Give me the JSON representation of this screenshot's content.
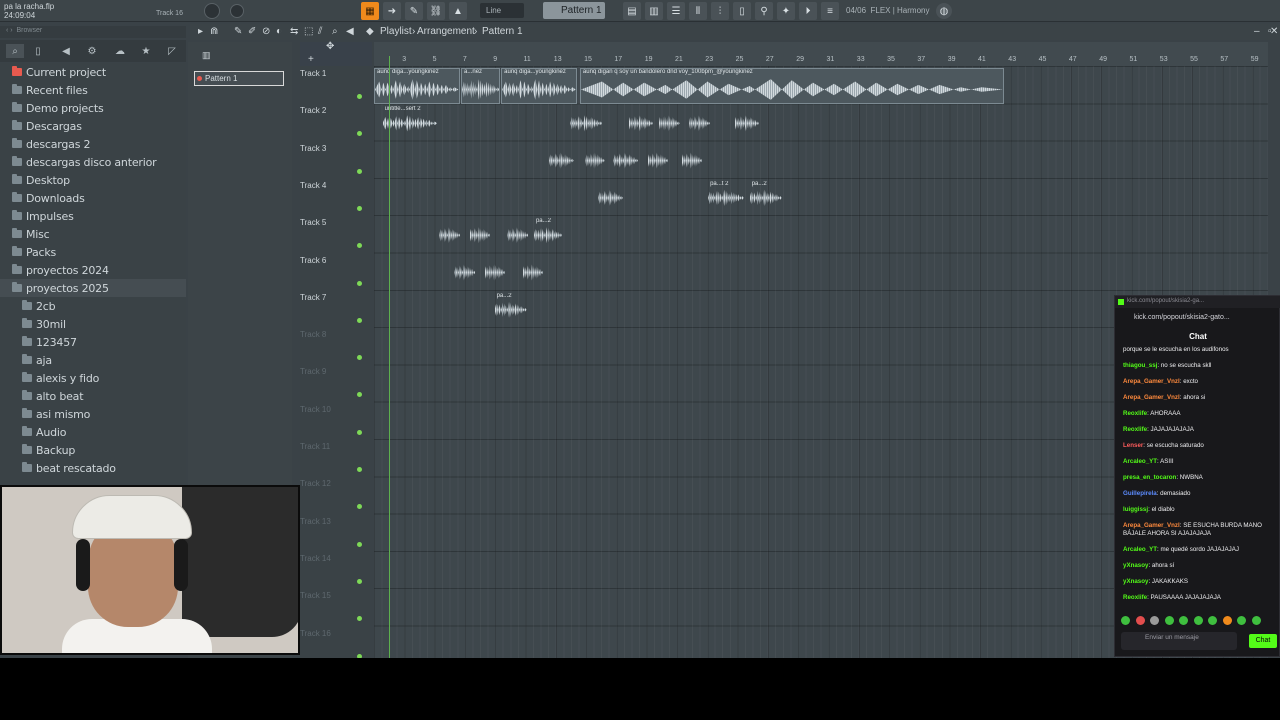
{
  "window": {
    "project_file": "pa la racha.flp",
    "time": "24:09:04",
    "track_hint": "Track 16",
    "snap_mode": "Line",
    "pattern_selector": "Pattern 1",
    "plugin_label": "FLEX | Harmony",
    "cpu_label": "04/06"
  },
  "browser": {
    "header": "Browser",
    "items": [
      {
        "label": "Current project",
        "level": 0,
        "current": true
      },
      {
        "label": "Recent files",
        "level": 0
      },
      {
        "label": "Demo projects",
        "level": 0
      },
      {
        "label": "Descargas",
        "level": 0
      },
      {
        "label": "descargas 2",
        "level": 0
      },
      {
        "label": "descargas disco anterior",
        "level": 0
      },
      {
        "label": "Desktop",
        "level": 0
      },
      {
        "label": "Downloads",
        "level": 0
      },
      {
        "label": "Impulses",
        "level": 0
      },
      {
        "label": "Misc",
        "level": 0
      },
      {
        "label": "Packs",
        "level": 0
      },
      {
        "label": "proyectos 2024",
        "level": 0
      },
      {
        "label": "proyectos 2025",
        "level": 0,
        "selected": true
      },
      {
        "label": "2cb",
        "level": 1
      },
      {
        "label": "30mil",
        "level": 1
      },
      {
        "label": "123457",
        "level": 1
      },
      {
        "label": "aja",
        "level": 1
      },
      {
        "label": "alexis y fido",
        "level": 1
      },
      {
        "label": "alto beat",
        "level": 1
      },
      {
        "label": "asi mismo",
        "level": 1
      },
      {
        "label": "Audio",
        "level": 1
      },
      {
        "label": "Backup",
        "level": 1
      },
      {
        "label": "beat rescatado",
        "level": 1
      }
    ]
  },
  "picker": {
    "pattern_label": "Pattern 1"
  },
  "playlist": {
    "title_parts": [
      "Playlist",
      "Arrangement",
      "Pattern 1"
    ],
    "ruler_numbers": [
      "3",
      "5",
      "7",
      "9",
      "11",
      "13",
      "15",
      "17",
      "19",
      "21",
      "23",
      "25",
      "27",
      "29",
      "31",
      "33",
      "35",
      "37",
      "39",
      "41",
      "43",
      "45",
      "47",
      "49",
      "51",
      "53",
      "55",
      "57",
      "59"
    ],
    "tracks": [
      "Track 1",
      "Track 2",
      "Track 3",
      "Track 4",
      "Track 5",
      "Track 6",
      "Track 7",
      "Track 8",
      "Track 9",
      "Track 10",
      "Track 11",
      "Track 12",
      "Track 13",
      "Track 14",
      "Track 15",
      "Track 16"
    ],
    "clips": [
      {
        "track": 0,
        "start": 0,
        "len": 11.3,
        "label": "aunq diga...youngkinez",
        "style": "full"
      },
      {
        "track": 0,
        "start": 11.5,
        "len": 5.2,
        "label": "a...nez",
        "style": "full"
      },
      {
        "track": 0,
        "start": 16.8,
        "len": 10.0,
        "label": "aunq diga...youngkinez",
        "style": "full"
      },
      {
        "track": 0,
        "start": 27.2,
        "len": 56.0,
        "label": "aunq digan q soy un bandolero dnd voy_100bpm_@youngkinez",
        "style": "full"
      },
      {
        "track": 1,
        "start": 1.0,
        "len": 7.5,
        "label": "untitle...sert 2",
        "style": "small"
      },
      {
        "track": 1,
        "start": 25.8,
        "len": 4.5,
        "label": "",
        "style": "small"
      },
      {
        "track": 1,
        "start": 33.5,
        "len": 3.5,
        "label": "",
        "style": "small"
      },
      {
        "track": 1,
        "start": 37.5,
        "len": 3.0,
        "label": "",
        "style": "small"
      },
      {
        "track": 1,
        "start": 41.5,
        "len": 3.0,
        "label": "",
        "style": "small"
      },
      {
        "track": 1,
        "start": 47.5,
        "len": 3.5,
        "label": "",
        "style": "small"
      },
      {
        "track": 2,
        "start": 23.0,
        "len": 3.5,
        "label": "",
        "style": "small"
      },
      {
        "track": 2,
        "start": 27.8,
        "len": 2.8,
        "label": "",
        "style": "small"
      },
      {
        "track": 2,
        "start": 31.5,
        "len": 3.5,
        "label": "",
        "style": "small"
      },
      {
        "track": 2,
        "start": 36.0,
        "len": 3.0,
        "label": "",
        "style": "small"
      },
      {
        "track": 2,
        "start": 40.5,
        "len": 3.0,
        "label": "",
        "style": "small"
      },
      {
        "track": 3,
        "start": 29.5,
        "len": 3.5,
        "label": "",
        "style": "small"
      },
      {
        "track": 3,
        "start": 44.0,
        "len": 5.0,
        "label": "pa...t 2",
        "style": "small"
      },
      {
        "track": 3,
        "start": 49.5,
        "len": 4.5,
        "label": "pa...2",
        "style": "small"
      },
      {
        "track": 4,
        "start": 8.5,
        "len": 3.0,
        "label": "",
        "style": "small"
      },
      {
        "track": 4,
        "start": 12.5,
        "len": 3.0,
        "label": "",
        "style": "small"
      },
      {
        "track": 4,
        "start": 17.5,
        "len": 3.0,
        "label": "",
        "style": "small"
      },
      {
        "track": 4,
        "start": 21.0,
        "len": 4.0,
        "label": "pa...2",
        "style": "small"
      },
      {
        "track": 5,
        "start": 10.5,
        "len": 3.0,
        "label": "",
        "style": "small"
      },
      {
        "track": 5,
        "start": 14.5,
        "len": 3.0,
        "label": "",
        "style": "small"
      },
      {
        "track": 5,
        "start": 19.5,
        "len": 3.0,
        "label": "",
        "style": "small"
      },
      {
        "track": 6,
        "start": 15.8,
        "len": 4.5,
        "label": "pa...2",
        "style": "small"
      }
    ]
  },
  "chat": {
    "window_title": "kick.com/popout/skisia2-ga...",
    "url": "kick.com/popout/skisia2-gato...",
    "title": "Chat",
    "messages": [
      {
        "user": "",
        "text": "porque se le escucha en los audifonos",
        "color": "#efeff1"
      },
      {
        "user": "thiagou_ssj",
        "text": "no se escucha skll",
        "color": "#53fc18"
      },
      {
        "user": "Arepa_Gamer_Vnzl",
        "text": "excto",
        "color": "#ff8a3d"
      },
      {
        "user": "Arepa_Gamer_Vnzl",
        "text": "ahora si",
        "color": "#ff8a3d"
      },
      {
        "user": "Reoxlife",
        "text": "AHORAAA",
        "color": "#53fc18"
      },
      {
        "user": "Reoxlife",
        "text": "JAJAJAJAJAJA",
        "color": "#53fc18"
      },
      {
        "user": "Lenser",
        "text": "se escucha saturado",
        "color": "#ff5c5c"
      },
      {
        "user": "Arcaleo_YT",
        "text": "ASIII",
        "color": "#53fc18"
      },
      {
        "user": "presa_en_tocaron",
        "text": "NWBNA",
        "color": "#53fc18"
      },
      {
        "user": "Guillepirela",
        "text": "demasiado",
        "color": "#5c8cff"
      },
      {
        "user": "luiggissj",
        "text": "el diablo",
        "color": "#53fc18"
      },
      {
        "user": "Arepa_Gamer_Vnzl",
        "text": "SE ESUCHA BURDA MANO BÁJALE AHORA SI AJAJAJAJA",
        "color": "#ff8a3d"
      },
      {
        "user": "Arcaleo_YT",
        "text": "me quedé sordo JAJAJAJAJ",
        "color": "#53fc18"
      },
      {
        "user": "yXnasoy",
        "text": "ahora sí",
        "color": "#53fc18"
      },
      {
        "user": "yXnasoy",
        "text": "JAKAKKAKS",
        "color": "#53fc18"
      },
      {
        "user": "Reoxlife",
        "text": "PAUSAAAA JAJAJAJAJA",
        "color": "#53fc18"
      }
    ],
    "input_placeholder": "Enviar un mensaje",
    "send_label": "Chat"
  }
}
